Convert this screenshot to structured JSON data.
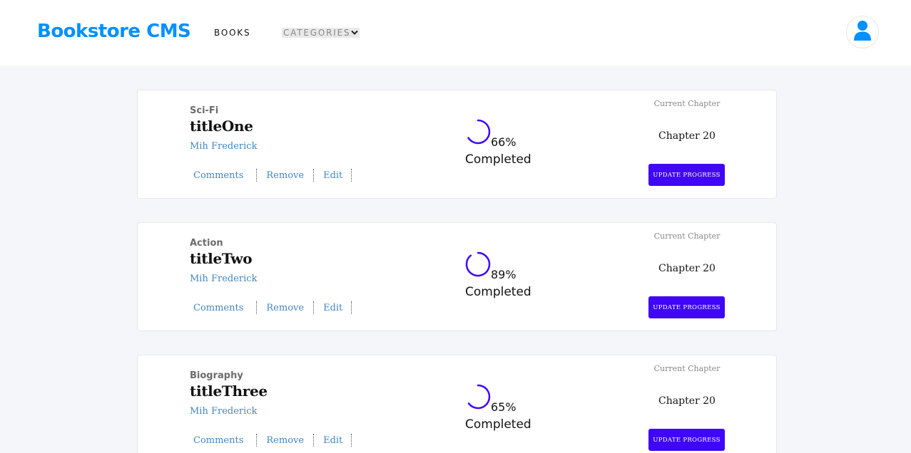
{
  "header": {
    "logo": "Bookstore CMS",
    "nav": {
      "books": "BOOKS",
      "categories": "CATEGORIES"
    }
  },
  "icons": {
    "avatar": "user-icon",
    "dropdown": "chevron-down-icon"
  },
  "colors": {
    "brand": "#0290ff",
    "progress_arc": "#3f07f5",
    "button": "#3f07f5",
    "link": "#4386bf"
  },
  "books": [
    {
      "category": "Sci-Fi",
      "title": "titleOne",
      "author": "Mih Frederick",
      "actions": [
        "Comments",
        "Remove",
        "Edit"
      ],
      "progress_percent": 66,
      "percent_label": "66%",
      "completed_label": "Completed",
      "chapter_label": "Current Chapter",
      "chapter": "Chapter 20",
      "button_label": "UPDATE PROGRESS"
    },
    {
      "category": "Action",
      "title": "titleTwo",
      "author": "Mih Frederick",
      "actions": [
        "Comments",
        "Remove",
        "Edit"
      ],
      "progress_percent": 89,
      "percent_label": "89%",
      "completed_label": "Completed",
      "chapter_label": "Current Chapter",
      "chapter": "Chapter 20",
      "button_label": "UPDATE PROGRESS"
    },
    {
      "category": "Biography",
      "title": "titleThree",
      "author": "Mih Frederick",
      "actions": [
        "Comments",
        "Remove",
        "Edit"
      ],
      "progress_percent": 65,
      "percent_label": "65%",
      "completed_label": "Completed",
      "chapter_label": "Current Chapter",
      "chapter": "Chapter 20",
      "button_label": "UPDATE PROGRESS"
    }
  ]
}
